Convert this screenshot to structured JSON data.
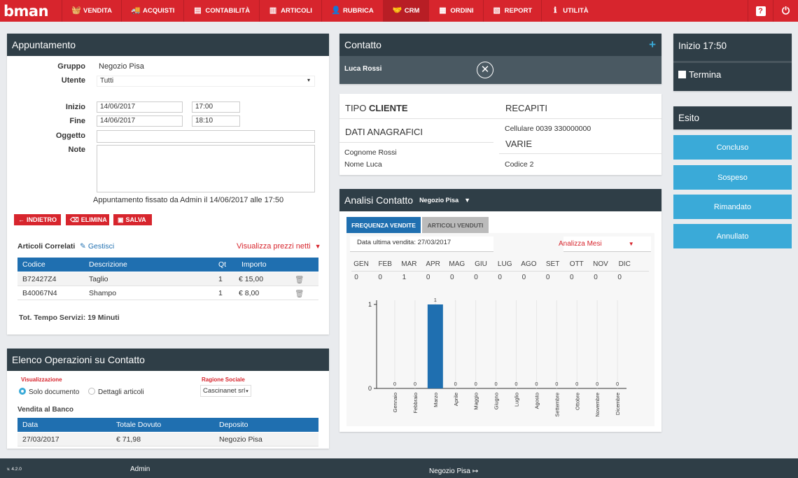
{
  "app": {
    "logo": "bman",
    "version": "v. 4.2.0"
  },
  "nav": [
    {
      "label": "VENDITA",
      "icon": "basket-icon",
      "glyph": "🧺"
    },
    {
      "label": "ACQUISTI",
      "icon": "truck-icon",
      "glyph": "🚚"
    },
    {
      "label": "CONTABILITÀ",
      "icon": "ledger-icon",
      "glyph": "▤"
    },
    {
      "label": "ARTICOLI",
      "icon": "barcode-icon",
      "glyph": "▥"
    },
    {
      "label": "RUBRICA",
      "icon": "user-icon",
      "glyph": "👤"
    },
    {
      "label": "CRM",
      "icon": "handshake-icon",
      "glyph": "🤝"
    },
    {
      "label": "ORDINI",
      "icon": "orders-icon",
      "glyph": "▦"
    },
    {
      "label": "REPORT",
      "icon": "report-icon",
      "glyph": "▧"
    },
    {
      "label": "UTILITÀ",
      "icon": "info-icon",
      "glyph": "ℹ"
    }
  ],
  "top_icons": {
    "help": "?",
    "power": "⏻"
  },
  "appuntamento": {
    "title": "Appuntamento",
    "gruppo_label": "Gruppo",
    "gruppo_value": "Negozio Pisa",
    "utente_label": "Utente",
    "utente_value": "Tutti",
    "inizio_label": "Inizio",
    "inizio_date": "14/06/2017",
    "inizio_time": "17:00",
    "fine_label": "Fine",
    "fine_date": "14/06/2017",
    "fine_time": "18:10",
    "oggetto_label": "Oggetto",
    "oggetto_value": "",
    "note_label": "Note",
    "note_value": "",
    "fissato": "Appuntamento fissato da Admin il 14/06/2017 alle 17:50",
    "btn_indietro": "INDIETRO",
    "btn_elimina": "ELIMINA",
    "btn_salva": "SALVA",
    "correlati_label": "Articoli Correlati",
    "gestisci": "Gestisci",
    "prezzi_netti": "Visualizza prezzi netti",
    "table_headers": [
      "Codice",
      "Descrizione",
      "Qt",
      "Importo"
    ],
    "rows": [
      {
        "codice": "B72427Z4",
        "descrizione": "Taglio",
        "qt": "1",
        "importo": "€ 15,00"
      },
      {
        "codice": "B40067N4",
        "descrizione": "Shampo",
        "qt": "1",
        "importo": "€ 8,00"
      }
    ],
    "tot_tempo": "Tot. Tempo Servizi: 19 Minuti"
  },
  "operazioni": {
    "title": "Elenco Operazioni su Contatto",
    "visualizzazione_label": "Visualizzazione",
    "opt_solo": "Solo documento",
    "opt_dettagli": "Dettagli articoli",
    "ragione_label": "Ragione Sociale",
    "ragione_value": "Cascinanet srl",
    "vendita_banco": "Vendita al Banco",
    "headers": [
      "Data",
      "Totale Dovuto",
      "Deposito"
    ],
    "rows": [
      {
        "data": "27/03/2017",
        "totale": "€ 71,98",
        "deposito": "Negozio Pisa"
      }
    ]
  },
  "contatto": {
    "title": "Contatto",
    "plus": "+",
    "name": "Luca Rossi",
    "tipo_cliente_a": "TIPO",
    "tipo_cliente_b": "CLIENTE",
    "dati_anagrafici": "DATI ANAGRAFICI",
    "cognome_label": "Cognome",
    "cognome_value": "Rossi",
    "nome_label": "Nome",
    "nome_value": "Luca",
    "recapiti": "RECAPITI",
    "cellulare_label": "Cellulare",
    "cellulare_value": "0039 330000000",
    "varie": "VARIE",
    "codice_label": "Codice",
    "codice_value": "2"
  },
  "analisi": {
    "title": "Analisi Contatto",
    "store": "Negozio Pisa",
    "tab_frequenza": "FREQUENZA VENDITE",
    "tab_articoli": "ARTICOLI VENDUTI",
    "ultima_vendita": "Data ultima vendita: 27/03/2017",
    "analizza": "Analizza Mesi",
    "months_short": [
      "GEN",
      "FEB",
      "MAR",
      "APR",
      "MAG",
      "GIU",
      "LUG",
      "AGO",
      "SET",
      "OTT",
      "NOV",
      "DIC"
    ],
    "month_values": [
      "0",
      "0",
      "1",
      "0",
      "0",
      "0",
      "0",
      "0",
      "0",
      "0",
      "0",
      "0"
    ]
  },
  "chart_data": {
    "type": "bar",
    "categories": [
      "Gennaio",
      "Febbraio",
      "Marzo",
      "Aprile",
      "Maggio",
      "Giugno",
      "Luglio",
      "Agosto",
      "Settembre",
      "Ottobre",
      "Novembre",
      "Dicembre"
    ],
    "values": [
      0,
      0,
      1,
      0,
      0,
      0,
      0,
      0,
      0,
      0,
      0,
      0
    ],
    "ylim": [
      0,
      1
    ],
    "yticks": [
      "0",
      "1"
    ],
    "color": "#1f6fb0"
  },
  "inizio_panel": {
    "title": "Inizio 17:50",
    "termina": "Termina"
  },
  "esito": {
    "title": "Esito",
    "buttons": [
      "Concluso",
      "Sospeso",
      "Rimandato",
      "Annullato"
    ]
  },
  "footer": {
    "user": "Admin",
    "store": "Negozio Pisa"
  },
  "colors": {
    "brand": "#d7252d",
    "header": "#2f3e47",
    "accent": "#1f6fb0",
    "esito": "#3aaad8"
  }
}
